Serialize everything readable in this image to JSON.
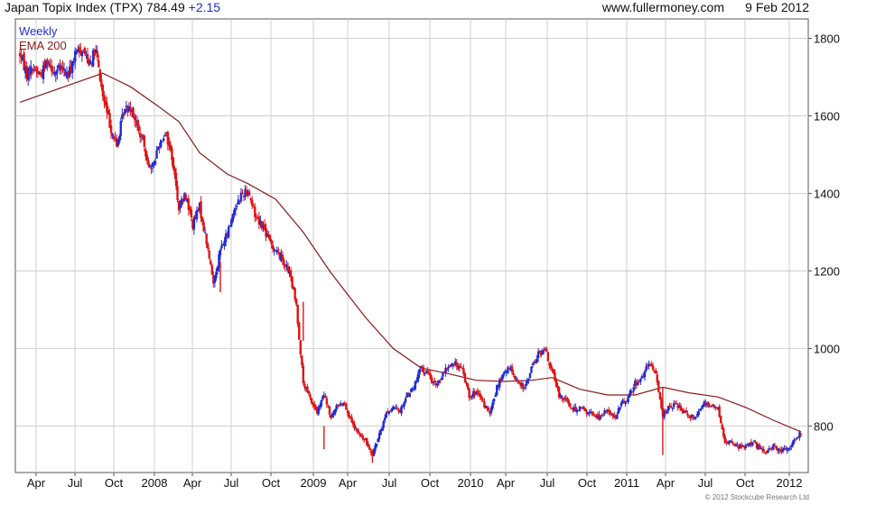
{
  "header": {
    "title": "Japan Topix Index (TPX) 784.49",
    "change": "+2.15",
    "website": "www.fullermoney.com",
    "date": "9 Feb 2012"
  },
  "legend": {
    "weekly": "Weekly",
    "ema": "EMA 200"
  },
  "copyright": "© 2012 Stockcube Research Ltd",
  "colors": {
    "up": "#1f2bd6",
    "down": "#e01414",
    "ema": "#8b1a1a",
    "grid": "#cfcfcf",
    "frame": "#555555",
    "change": "#1f2bd6",
    "legend_weekly": "#1f2bd6",
    "legend_ema": "#8b1a1a"
  },
  "chart_data": {
    "type": "candlestick",
    "period": "weekly",
    "x_tick_labels": [
      "Apr",
      "Jul",
      "Oct",
      "2008",
      "Apr",
      "Jul",
      "Oct",
      "2009",
      "Apr",
      "Jul",
      "Oct",
      "2010",
      "Apr",
      "Jul",
      "Oct",
      "2011",
      "Apr",
      "Jul",
      "Oct",
      "2012"
    ],
    "y_ticks": [
      800,
      1000,
      1200,
      1400,
      1600,
      1800
    ],
    "ylim": [
      680,
      1850
    ],
    "grid": true,
    "y_axis_position": "right",
    "close_path": [
      [
        0,
        1760
      ],
      [
        1,
        1710
      ],
      [
        2,
        1725
      ],
      [
        3,
        1705
      ],
      [
        4,
        1745
      ],
      [
        5,
        1715
      ],
      [
        6,
        1720
      ],
      [
        7,
        1705
      ],
      [
        8,
        1755
      ],
      [
        9,
        1775
      ],
      [
        10,
        1740
      ],
      [
        11,
        1765
      ],
      [
        12,
        1650
      ],
      [
        13,
        1580
      ],
      [
        14,
        1520
      ],
      [
        15,
        1610
      ],
      [
        16,
        1630
      ],
      [
        17,
        1570
      ],
      [
        18,
        1520
      ],
      [
        19,
        1455
      ],
      [
        20,
        1520
      ],
      [
        21,
        1560
      ],
      [
        22,
        1495
      ],
      [
        23,
        1365
      ],
      [
        24,
        1395
      ],
      [
        25,
        1320
      ],
      [
        26,
        1365
      ],
      [
        27,
        1275
      ],
      [
        28,
        1170
      ],
      [
        29,
        1255
      ],
      [
        30,
        1295
      ],
      [
        31,
        1360
      ],
      [
        32,
        1395
      ],
      [
        33,
        1410
      ],
      [
        34,
        1345
      ],
      [
        35,
        1320
      ],
      [
        36,
        1280
      ],
      [
        37,
        1255
      ],
      [
        38,
        1230
      ],
      [
        39,
        1195
      ],
      [
        40,
        1110
      ],
      [
        41,
        910
      ],
      [
        42,
        870
      ],
      [
        43,
        835
      ],
      [
        44,
        880
      ],
      [
        45,
        820
      ],
      [
        46,
        855
      ],
      [
        47,
        860
      ],
      [
        48,
        805
      ],
      [
        49,
        780
      ],
      [
        50,
        760
      ],
      [
        51,
        730
      ],
      [
        52,
        775
      ],
      [
        53,
        835
      ],
      [
        54,
        845
      ],
      [
        55,
        840
      ],
      [
        56,
        880
      ],
      [
        57,
        900
      ],
      [
        58,
        950
      ],
      [
        59,
        935
      ],
      [
        60,
        905
      ],
      [
        61,
        925
      ],
      [
        62,
        955
      ],
      [
        63,
        960
      ],
      [
        64,
        945
      ],
      [
        65,
        880
      ],
      [
        66,
        885
      ],
      [
        67,
        860
      ],
      [
        68,
        830
      ],
      [
        69,
        900
      ],
      [
        70,
        935
      ],
      [
        71,
        950
      ],
      [
        72,
        915
      ],
      [
        73,
        895
      ],
      [
        74,
        950
      ],
      [
        75,
        985
      ],
      [
        76,
        995
      ],
      [
        77,
        940
      ],
      [
        78,
        880
      ],
      [
        79,
        870
      ],
      [
        80,
        840
      ],
      [
        81,
        850
      ],
      [
        82,
        835
      ],
      [
        83,
        830
      ],
      [
        84,
        820
      ],
      [
        85,
        845
      ],
      [
        86,
        820
      ],
      [
        87,
        855
      ],
      [
        88,
        875
      ],
      [
        89,
        910
      ],
      [
        90,
        925
      ],
      [
        91,
        960
      ],
      [
        92,
        935
      ],
      [
        93,
        830
      ],
      [
        94,
        850
      ],
      [
        95,
        855
      ],
      [
        96,
        840
      ],
      [
        97,
        825
      ],
      [
        98,
        830
      ],
      [
        99,
        860
      ],
      [
        100,
        855
      ],
      [
        101,
        845
      ],
      [
        102,
        755
      ],
      [
        103,
        760
      ],
      [
        104,
        745
      ],
      [
        105,
        750
      ],
      [
        106,
        760
      ],
      [
        107,
        740
      ],
      [
        108,
        730
      ],
      [
        109,
        750
      ],
      [
        110,
        735
      ],
      [
        111,
        740
      ],
      [
        112,
        760
      ],
      [
        113,
        784
      ]
    ],
    "ema_200": [
      [
        0,
        1635
      ],
      [
        12,
        1710
      ],
      [
        16,
        1675
      ],
      [
        20,
        1625
      ],
      [
        23,
        1585
      ],
      [
        26,
        1505
      ],
      [
        30,
        1450
      ],
      [
        33,
        1425
      ],
      [
        37,
        1385
      ],
      [
        41,
        1300
      ],
      [
        45,
        1195
      ],
      [
        50,
        1080
      ],
      [
        54,
        1000
      ],
      [
        58,
        950
      ],
      [
        62,
        935
      ],
      [
        66,
        918
      ],
      [
        70,
        915
      ],
      [
        74,
        918
      ],
      [
        77,
        925
      ],
      [
        81,
        895
      ],
      [
        85,
        880
      ],
      [
        89,
        880
      ],
      [
        93,
        900
      ],
      [
        97,
        885
      ],
      [
        101,
        875
      ],
      [
        105,
        848
      ],
      [
        109,
        815
      ],
      [
        113,
        785
      ]
    ],
    "spikes": [
      [
        29,
        1225,
        1145
      ],
      [
        41,
        1120,
        1020
      ],
      [
        44,
        800,
        740
      ],
      [
        51,
        740,
        705
      ],
      [
        93,
        900,
        725
      ]
    ]
  }
}
